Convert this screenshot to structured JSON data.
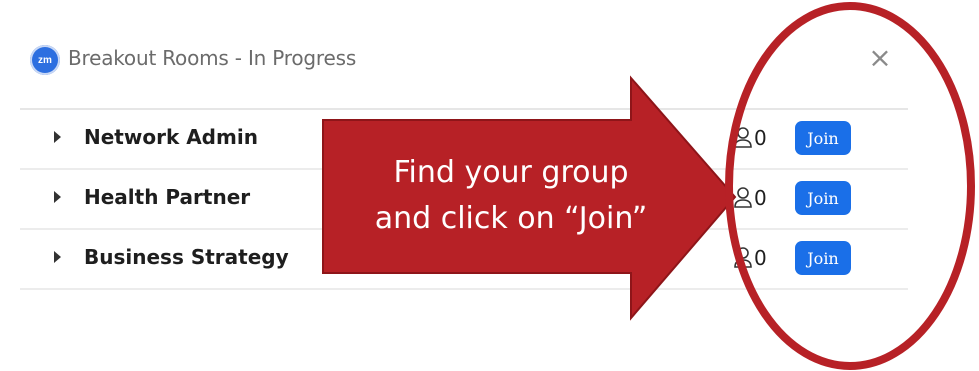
{
  "window": {
    "title": "Breakout Rooms - In Progress",
    "close_label": "×",
    "logo_text": "zm"
  },
  "rooms": [
    {
      "name": "Network Admin",
      "count": "0",
      "join_label": "Join"
    },
    {
      "name": "Health Partner",
      "count": "0",
      "join_label": "Join"
    },
    {
      "name": "Business Strategy",
      "count": "0",
      "join_label": "Join"
    }
  ],
  "callout": {
    "line1": "Find your group",
    "line2": "and click on “Join”"
  },
  "colors": {
    "join_button": "#1a6fe8",
    "arrow_fill": "#b72126",
    "circle_stroke": "#b72126"
  },
  "icons": {
    "participants": "person-icon",
    "expand": "caret-right-icon",
    "close": "close-icon"
  }
}
